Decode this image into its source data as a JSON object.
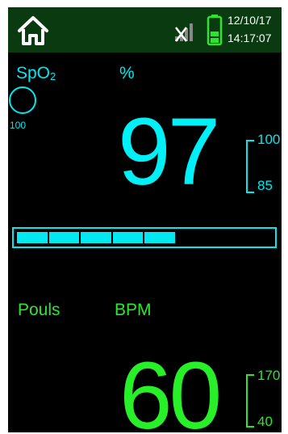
{
  "header": {
    "date": "12/10/17",
    "time": "14:17:07",
    "home_icon": "home-icon",
    "signal_icon": "no-signal-icon",
    "battery_icon": "battery-icon",
    "battery_level": 0.5
  },
  "spo2": {
    "label_main": "SpO",
    "label_sub": "2",
    "unit": "%",
    "value": "97",
    "small_value": "100",
    "range_high": "100",
    "range_low": "85",
    "bar_segments_filled": 5,
    "bar_segments_total": 8,
    "color": "#00e8f0"
  },
  "pulse": {
    "label": "Pouls",
    "unit": "BPM",
    "value": "60",
    "range_high": "170",
    "range_low": "40",
    "color": "#2ee52e"
  }
}
